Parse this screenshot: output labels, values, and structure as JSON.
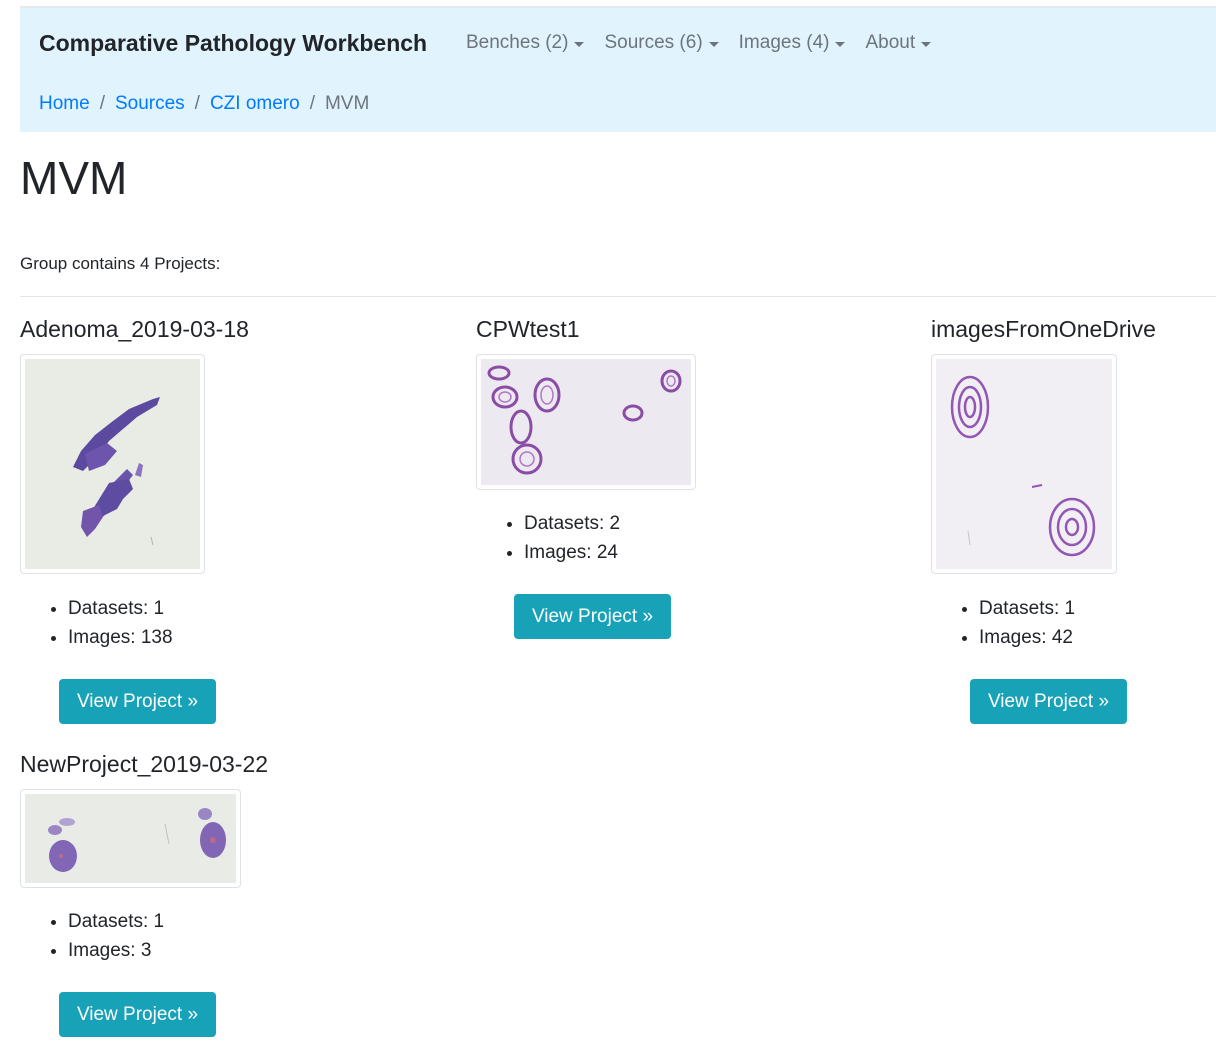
{
  "navbar": {
    "brand": "Comparative Pathology Workbench",
    "menu": [
      {
        "label": "Benches (2)"
      },
      {
        "label": "Sources (6)"
      },
      {
        "label": "Images (4)"
      },
      {
        "label": "About"
      }
    ]
  },
  "breadcrumb": {
    "items": [
      "Home",
      "Sources",
      "CZI omero"
    ],
    "current": "MVM",
    "separator": "/"
  },
  "page": {
    "title": "MVM",
    "summary": "Group contains 4 Projects:"
  },
  "projects": [
    {
      "name": "Adenoma_2019-03-18",
      "datasets": "Datasets: 1",
      "images": "Images: 138",
      "button": "View Project »"
    },
    {
      "name": "CPWtest1",
      "datasets": "Datasets: 2",
      "images": "Images: 24",
      "button": "View Project »"
    },
    {
      "name": "imagesFromOneDrive",
      "datasets": "Datasets: 1",
      "images": "Images: 42",
      "button": "View Project »"
    },
    {
      "name": "NewProject_2019-03-22",
      "datasets": "Datasets: 1",
      "images": "Images: 3",
      "button": "View Project »"
    }
  ],
  "colors": {
    "navbar_bg": "#e1f3fd",
    "link": "#007bff",
    "button": "#17a2b8",
    "stain": "#7b5cb0"
  }
}
